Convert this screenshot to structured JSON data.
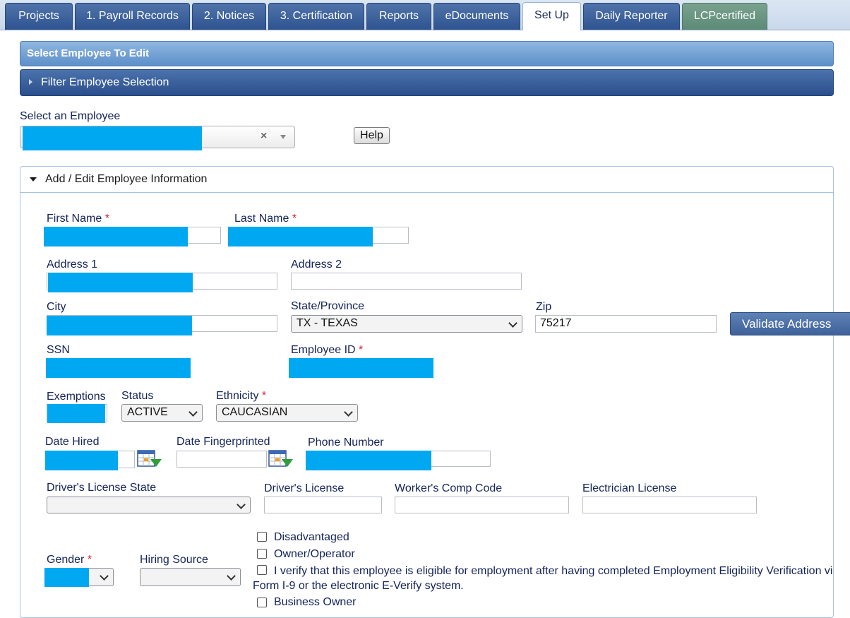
{
  "tabs": [
    {
      "label": "Projects",
      "active": false
    },
    {
      "label": "1. Payroll Records",
      "active": false
    },
    {
      "label": "2. Notices",
      "active": false
    },
    {
      "label": "3. Certification",
      "active": false
    },
    {
      "label": "Reports",
      "active": false
    },
    {
      "label": "eDocuments",
      "active": false
    },
    {
      "label": "Set Up",
      "active": true
    },
    {
      "label": "Daily Reporter",
      "active": false
    },
    {
      "label": "LCPcertified",
      "active": false
    }
  ],
  "headers": {
    "select_employee": "Select Employee To Edit",
    "filter_selection": "Filter Employee Selection"
  },
  "employee_select": {
    "label": "Select an Employee",
    "clear_glyph": "×",
    "help_label": "Help"
  },
  "section": {
    "title": "Add / Edit Employee Information"
  },
  "form": {
    "required_mark": "*",
    "first_name_label": "First Name",
    "last_name_label": "Last Name",
    "address1_label": "Address 1",
    "address2_label": "Address 2",
    "address2_value": "",
    "city_label": "City",
    "state_label": "State/Province",
    "state_value": "TX - TEXAS",
    "zip_label": "Zip",
    "zip_value": "75217",
    "validate_label": "Validate Address",
    "ssn_label": "SSN",
    "employee_id_label": "Employee ID",
    "exemptions_label": "Exemptions",
    "status_label": "Status",
    "status_value": "ACTIVE",
    "ethnicity_label": "Ethnicity",
    "ethnicity_value": "CAUCASIAN",
    "date_hired_label": "Date Hired",
    "date_fingerprinted_label": "Date Fingerprinted",
    "date_fingerprinted_value": "",
    "phone_label": "Phone Number",
    "dl_state_label": "Driver's License State",
    "dl_state_value": "",
    "dl_label": "Driver's License",
    "dl_value": "",
    "workers_comp_label": "Worker's Comp Code",
    "workers_comp_value": "",
    "electrician_label": "Electrician License",
    "electrician_value": "",
    "gender_label": "Gender",
    "hiring_source_label": "Hiring Source",
    "hiring_source_value": ""
  },
  "checkboxes": {
    "disadvantaged": {
      "label": "Disadvantaged",
      "checked": false
    },
    "owner_operator": {
      "label": "Owner/Operator",
      "checked": false
    },
    "verify_line1": "I verify that this employee is eligible for employment after having completed Employment Eligibility Verification vi",
    "verify_line2": "Form I-9 or the electronic E-Verify system.",
    "verify_checked": false,
    "business_owner": {
      "label": "Business Owner",
      "checked": false
    }
  },
  "icons": {
    "calendar": "calendar-icon",
    "expand": "triangle-right-icon",
    "collapse": "triangle-down-icon"
  },
  "colors": {
    "tab_blue": "#2f5390",
    "tab_green": "#5b8a76",
    "required_red": "#d0232c",
    "redaction": "#00a8f2"
  }
}
